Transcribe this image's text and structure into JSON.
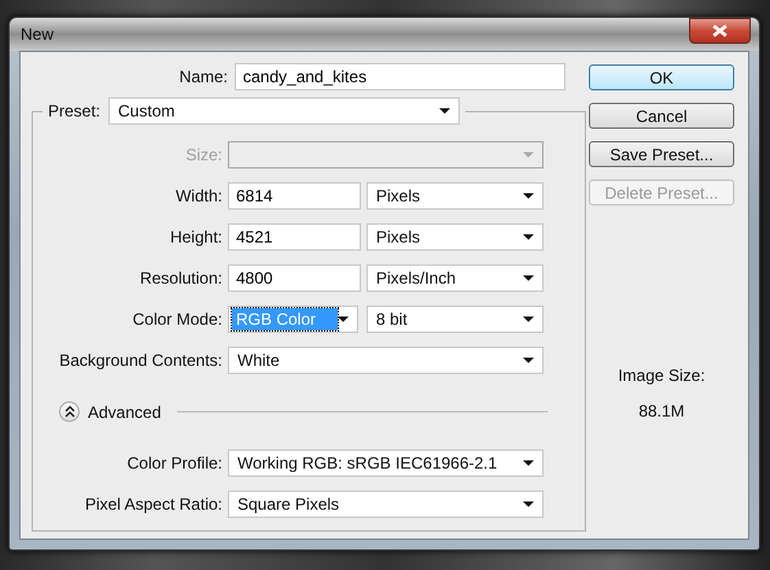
{
  "window": {
    "title": "New"
  },
  "name": {
    "label": "Name:",
    "value": "candy_and_kites"
  },
  "preset": {
    "label": "Preset:",
    "value": "Custom"
  },
  "fields": [
    {
      "kind": "select",
      "label": "Size:",
      "disabled": true
    },
    {
      "kind": "number",
      "label": "Width:",
      "value": "6814",
      "unit": "Pixels"
    },
    {
      "kind": "number",
      "label": "Height:",
      "value": "4521",
      "unit": "Pixels"
    },
    {
      "kind": "number",
      "label": "Resolution:",
      "value": "4800",
      "unit": "Pixels/Inch"
    },
    {
      "kind": "mode",
      "label": "Color Mode:",
      "value": "RGB Color",
      "focused": true,
      "unit": "8 bit"
    },
    {
      "kind": "select",
      "label": "Background Contents:",
      "value": "White",
      "disabled": false
    }
  ],
  "advanced": {
    "label": "Advanced",
    "expanded": true
  },
  "advanced_fields": [
    {
      "label": "Color Profile:",
      "value": "Working RGB:  sRGB IEC61966-2.1"
    },
    {
      "label": "Pixel Aspect Ratio:",
      "value": "Square Pixels"
    }
  ],
  "buttons": [
    {
      "label": "OK",
      "default": true,
      "disabled": false
    },
    {
      "label": "Cancel",
      "default": false,
      "disabled": false
    },
    {
      "label": "Save Preset...",
      "default": false,
      "disabled": false
    },
    {
      "label": "Delete Preset...",
      "default": false,
      "disabled": true
    }
  ],
  "image_size": {
    "label": "Image Size:",
    "value": "88.1M"
  }
}
